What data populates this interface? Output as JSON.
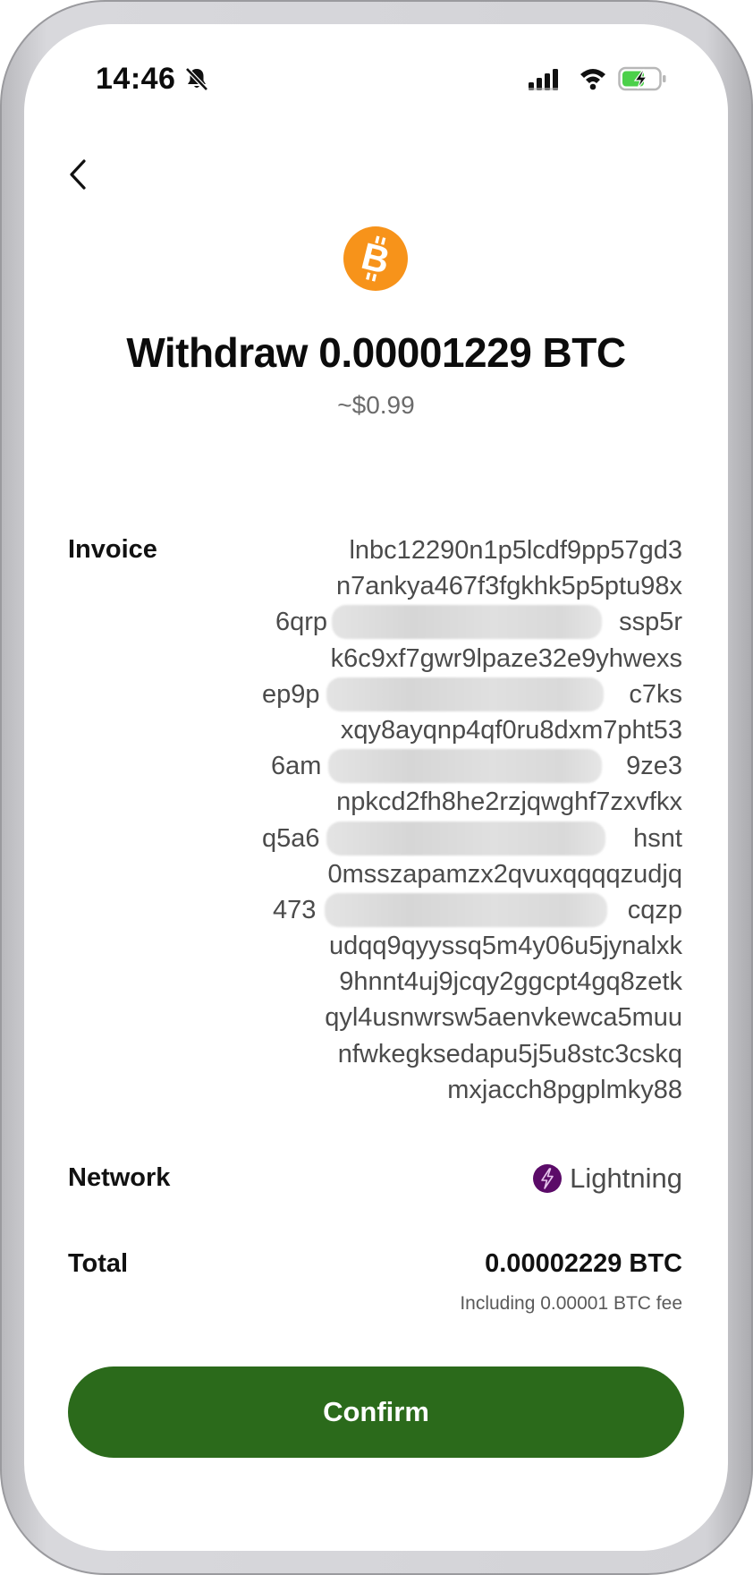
{
  "status_bar": {
    "time": "14:46",
    "icons": [
      "bell-slash-icon",
      "cellular-signal-icon",
      "wifi-icon",
      "battery-charging-icon"
    ],
    "battery_color": "#4cd04a"
  },
  "nav": {
    "back_icon": "chevron-left-icon"
  },
  "header": {
    "coin_icon": "bitcoin-icon",
    "coin_color": "#f7931a",
    "title": "Withdraw 0.00001229 BTC",
    "fiat_value": "~$0.99"
  },
  "details": {
    "invoice_label": "Invoice",
    "invoice_lines": [
      "lnbc12290n1p5lcdf9pp57gd3",
      "n7ankya467f3fgkhk5p5ptu98x",
      "6qrp",
      "ssp5r",
      "k6c9xf7gwr9lpaze32e9yhwexs",
      "ep9p",
      "c7ks",
      "xqy8ayqnp4qf0ru8dxm7pht53",
      "6am",
      "9ze3",
      "npkcd2fh8he2rzjqwghf7zxvfkx",
      "q5a6",
      "hsnt",
      "0msszapamzx2qvuxqqqqzudjq",
      "473",
      "cqzp",
      "udqq9qyyssq5m4y06u5jynalxk",
      "9hnnt4uj9jcqy2ggcpt4gq8zetk",
      "qyl4usnwrsw5aenvkewca5muu",
      "nfwkegksedapu5j5u8stc3cskq",
      "mxjacch8pgplmky88"
    ],
    "network_label": "Network",
    "network_value": "Lightning",
    "network_icon": "lightning-bolt-icon",
    "network_color": "#5b0b68",
    "total_label": "Total",
    "total_value": "0.00002229 BTC",
    "fee_note": "Including 0.00001 BTC fee"
  },
  "actions": {
    "confirm_label": "Confirm",
    "confirm_color": "#2b6a1b"
  }
}
